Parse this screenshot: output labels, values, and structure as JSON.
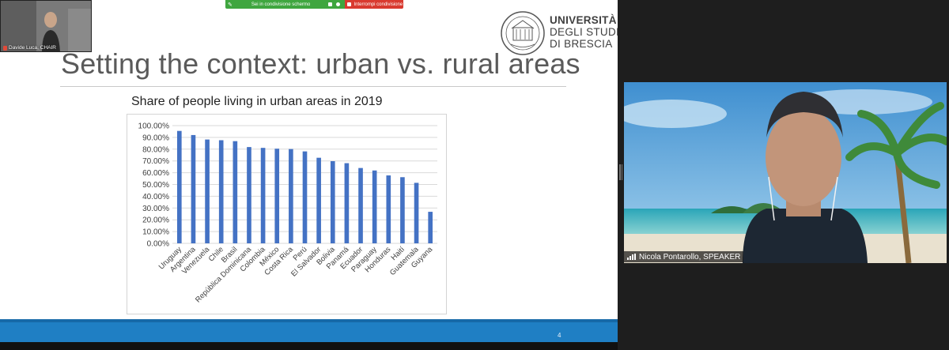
{
  "share_toolbar": {
    "sharing_label": "Sei in condivisione schermo",
    "stop_label": "Interrompi condivisione"
  },
  "chair": {
    "name_label": "Davide Luca, CHAIR"
  },
  "slide": {
    "title": "Setting the context: urban vs. rural areas",
    "page_number": "4",
    "logo": {
      "line1": "UNIVERSITÀ",
      "line2": "DEGLI STUDI",
      "line3": "DI BRESCIA"
    },
    "colors": {
      "bar": "#4472c4",
      "footer": "#1f7fc4",
      "title": "#5a5a5a"
    }
  },
  "chart_data": {
    "type": "bar",
    "title": "Share of people living in urban areas in 2019",
    "categories": [
      "Uruguay",
      "Argentina",
      "Venezuela",
      "Chile",
      "Brasil",
      "República Dominicana",
      "Colombia",
      "México",
      "Costa Rica",
      "Perú",
      "El Salvador",
      "Bolivia",
      "Panamá",
      "Ecuador",
      "Paraguay",
      "Honduras",
      "Haití",
      "Guatemala",
      "Guyana"
    ],
    "values": [
      95.5,
      92.0,
      88.2,
      87.6,
      86.8,
      81.8,
      81.1,
      80.4,
      80.1,
      78.1,
      72.7,
      69.8,
      68.1,
      64.0,
      61.9,
      57.7,
      56.2,
      51.4,
      26.8
    ],
    "ylim": [
      0,
      100
    ],
    "ytick_labels": [
      "100.00%",
      "90.00%",
      "80.00%",
      "70.00%",
      "60.00%",
      "50.00%",
      "40.00%",
      "30.00%",
      "20.00%",
      "10.00%",
      "0.00%"
    ],
    "xlabel": "",
    "ylabel": "",
    "grid": true,
    "legend": "none"
  },
  "speaker": {
    "name_label": "Nicola Pontarollo, SPEAKER"
  }
}
